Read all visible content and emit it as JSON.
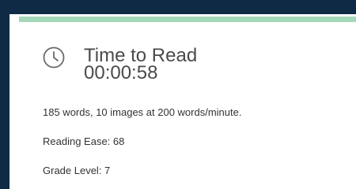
{
  "widget": {
    "title": "Time to Read",
    "time": "00:00:58",
    "stats": [
      "185 words, 10 images at 200 words/minute.",
      "Reading Ease: 68",
      "Grade Level: 7"
    ],
    "icon": "clock-icon"
  },
  "colors": {
    "outer_background": "#0e2a45",
    "accent_bar": "#a3d9b8",
    "panel_background": "#ffffff",
    "text": "#4a4a4a"
  }
}
